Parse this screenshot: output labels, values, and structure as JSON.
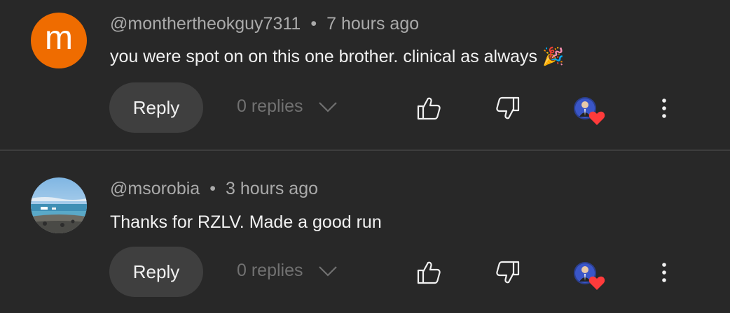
{
  "comments": [
    {
      "avatar_letter": "m",
      "avatar_color": "#ef6c00",
      "handle": "@monthertheokguy7311",
      "separator": "•",
      "time": "7 hours ago",
      "text": "you were spot on on this one brother. clinical as always 🎉",
      "reply_label": "Reply",
      "replies_label": "0 replies"
    },
    {
      "avatar_letter": "",
      "handle": "@msorobia",
      "separator": "•",
      "time": "3 hours ago",
      "text": "Thanks for RZLV. Made a good run",
      "reply_label": "Reply",
      "replies_label": "0 replies"
    }
  ],
  "icons": {
    "like": "thumbs-up-icon",
    "dislike": "thumbs-down-icon",
    "creator_heart": "creator-heart-icon",
    "more": "more-vertical-icon",
    "expand": "chevron-down-icon"
  },
  "colors": {
    "background": "#282828",
    "heart": "#ff3b3b",
    "button_bg": "#3f3f3f"
  }
}
